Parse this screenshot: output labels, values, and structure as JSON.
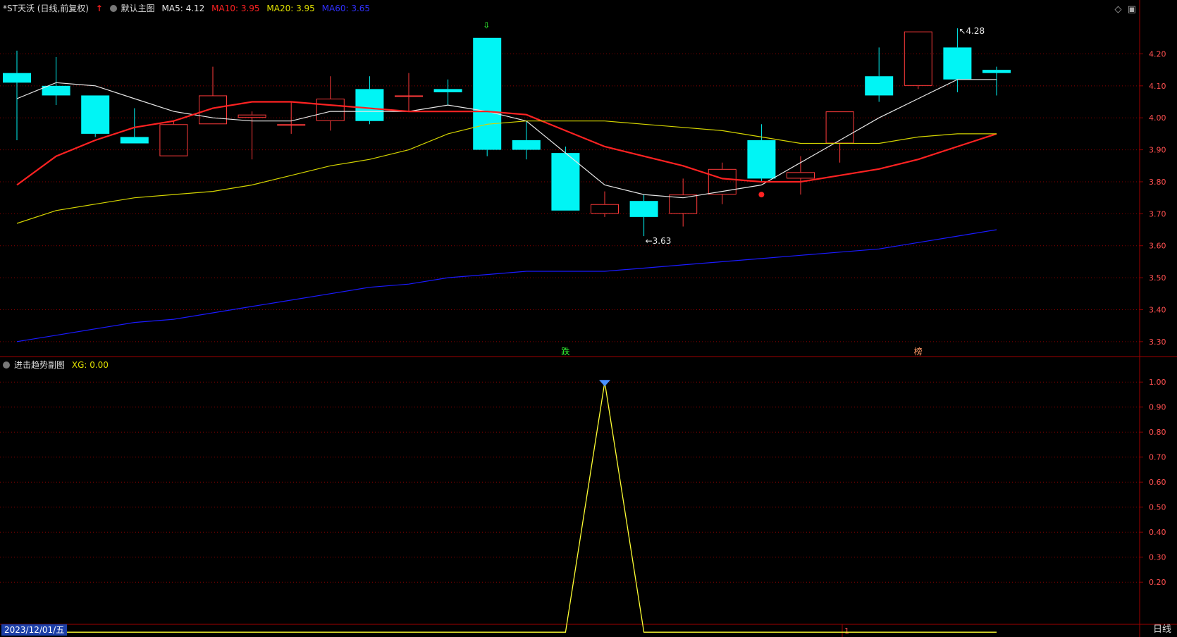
{
  "main_header": {
    "stock": "*ST天沃 (日线,前复权)",
    "template": "默认主图",
    "ma5": "MA5: 4.12",
    "ma10": "MA10: 3.95",
    "ma20": "MA20: 3.95",
    "ma60": "MA60: 3.65"
  },
  "sub_header": {
    "title": "进击趋势副图",
    "xg": "XG: 0.00"
  },
  "footer": {
    "date": "2023/12/01/五",
    "period": "日线",
    "page_marker": "1"
  },
  "colors": {
    "up": "#ff3b3b",
    "down": "#00f5f5",
    "ma5": "#e6e6e6",
    "ma10": "#ff2222",
    "ma20": "#d4d400",
    "ma60": "#1a1aff",
    "grid": "#8a0000",
    "signal": "#ffff33",
    "axis_text": "#ff5050"
  },
  "chart_data": [
    {
      "type": "candlestick",
      "title": "*ST天沃 (日线,前复权)",
      "ylim": [
        3.26,
        4.32
      ],
      "yticks": [
        "4.20",
        "4.10",
        "4.00",
        "3.90",
        "3.80",
        "3.70",
        "3.60",
        "3.50",
        "3.40",
        "3.30"
      ],
      "candles": [
        {
          "o": 4.14,
          "h": 4.21,
          "l": 3.93,
          "c": 4.11
        },
        {
          "o": 4.1,
          "h": 4.19,
          "l": 4.04,
          "c": 4.07
        },
        {
          "o": 4.07,
          "h": 4.07,
          "l": 3.94,
          "c": 3.95
        },
        {
          "o": 3.94,
          "h": 4.03,
          "l": 3.92,
          "c": 3.92
        },
        {
          "o": 3.88,
          "h": 3.99,
          "l": 3.88,
          "c": 3.98
        },
        {
          "o": 3.98,
          "h": 4.16,
          "l": 3.98,
          "c": 4.07
        },
        {
          "o": 4.0,
          "h": 4.02,
          "l": 3.87,
          "c": 4.01
        },
        {
          "o": 3.98,
          "h": 4.05,
          "l": 3.95,
          "c": 3.98
        },
        {
          "o": 3.99,
          "h": 4.13,
          "l": 3.96,
          "c": 4.06
        },
        {
          "o": 4.09,
          "h": 4.13,
          "l": 3.98,
          "c": 3.99
        },
        {
          "o": 4.07,
          "h": 4.14,
          "l": 4.02,
          "c": 4.07
        },
        {
          "o": 4.09,
          "h": 4.12,
          "l": 4.04,
          "c": 4.08
        },
        {
          "o": 4.25,
          "h": 4.25,
          "l": 3.88,
          "c": 3.9
        },
        {
          "o": 3.93,
          "h": 3.99,
          "l": 3.87,
          "c": 3.9
        },
        {
          "o": 3.89,
          "h": 3.91,
          "l": 3.71,
          "c": 3.71
        },
        {
          "o": 3.7,
          "h": 3.77,
          "l": 3.69,
          "c": 3.73
        },
        {
          "o": 3.74,
          "h": 3.76,
          "l": 3.63,
          "c": 3.69
        },
        {
          "o": 3.7,
          "h": 3.81,
          "l": 3.66,
          "c": 3.76
        },
        {
          "o": 3.76,
          "h": 3.86,
          "l": 3.73,
          "c": 3.84
        },
        {
          "o": 3.93,
          "h": 3.98,
          "l": 3.8,
          "c": 3.81
        },
        {
          "o": 3.81,
          "h": 3.88,
          "l": 3.76,
          "c": 3.83
        },
        {
          "o": 3.92,
          "h": 4.02,
          "l": 3.86,
          "c": 4.02
        },
        {
          "o": 4.13,
          "h": 4.22,
          "l": 4.05,
          "c": 4.07
        },
        {
          "o": 4.1,
          "h": 4.27,
          "l": 4.09,
          "c": 4.27
        },
        {
          "o": 4.22,
          "h": 4.28,
          "l": 4.08,
          "c": 4.12
        },
        {
          "o": 4.15,
          "h": 4.16,
          "l": 4.07,
          "c": 4.14
        }
      ],
      "series": [
        {
          "name": "MA5",
          "values": [
            4.06,
            4.11,
            4.1,
            4.06,
            4.02,
            4.0,
            3.99,
            3.99,
            4.02,
            4.02,
            4.02,
            4.04,
            4.02,
            3.99,
            3.89,
            3.79,
            3.76,
            3.75,
            3.77,
            3.79,
            3.86,
            3.93,
            4.0,
            4.06,
            4.12,
            4.12
          ]
        },
        {
          "name": "MA10",
          "values": [
            3.79,
            3.88,
            3.93,
            3.97,
            3.99,
            4.03,
            4.05,
            4.05,
            4.04,
            4.03,
            4.02,
            4.02,
            4.02,
            4.01,
            3.96,
            3.91,
            3.88,
            3.85,
            3.81,
            3.8,
            3.8,
            3.82,
            3.84,
            3.87,
            3.91,
            3.95
          ]
        },
        {
          "name": "MA20",
          "values": [
            3.67,
            3.71,
            3.73,
            3.75,
            3.76,
            3.77,
            3.79,
            3.82,
            3.85,
            3.87,
            3.9,
            3.95,
            3.98,
            3.99,
            3.99,
            3.99,
            3.98,
            3.97,
            3.96,
            3.94,
            3.92,
            3.92,
            3.92,
            3.94,
            3.95,
            3.95
          ]
        },
        {
          "name": "MA60",
          "values": [
            3.3,
            3.32,
            3.34,
            3.36,
            3.37,
            3.39,
            3.41,
            3.43,
            3.45,
            3.47,
            3.48,
            3.5,
            3.51,
            3.52,
            3.52,
            3.52,
            3.53,
            3.54,
            3.55,
            3.56,
            3.57,
            3.58,
            3.59,
            3.61,
            3.63,
            3.65
          ]
        }
      ],
      "annotations": [
        {
          "text": "4.28",
          "index": 24,
          "value": 4.28
        },
        {
          "text": "3.63",
          "index": 16,
          "value": 3.63
        },
        {
          "text": "跌",
          "index": 14
        },
        {
          "text": "榜",
          "index": 23
        }
      ]
    },
    {
      "type": "line",
      "title": "进击趋势副图",
      "ylim": [
        0.04,
        1.04
      ],
      "yticks": [
        "1.00",
        "0.90",
        "0.80",
        "0.70",
        "0.60",
        "0.50",
        "0.40",
        "0.30",
        "0.20"
      ],
      "series": [
        {
          "name": "XG",
          "values": [
            0,
            0,
            0,
            0,
            0,
            0,
            0,
            0,
            0,
            0,
            0,
            0,
            0,
            0,
            0,
            1,
            0,
            0,
            0,
            0,
            0,
            0,
            0,
            0,
            0,
            0
          ]
        }
      ]
    }
  ]
}
